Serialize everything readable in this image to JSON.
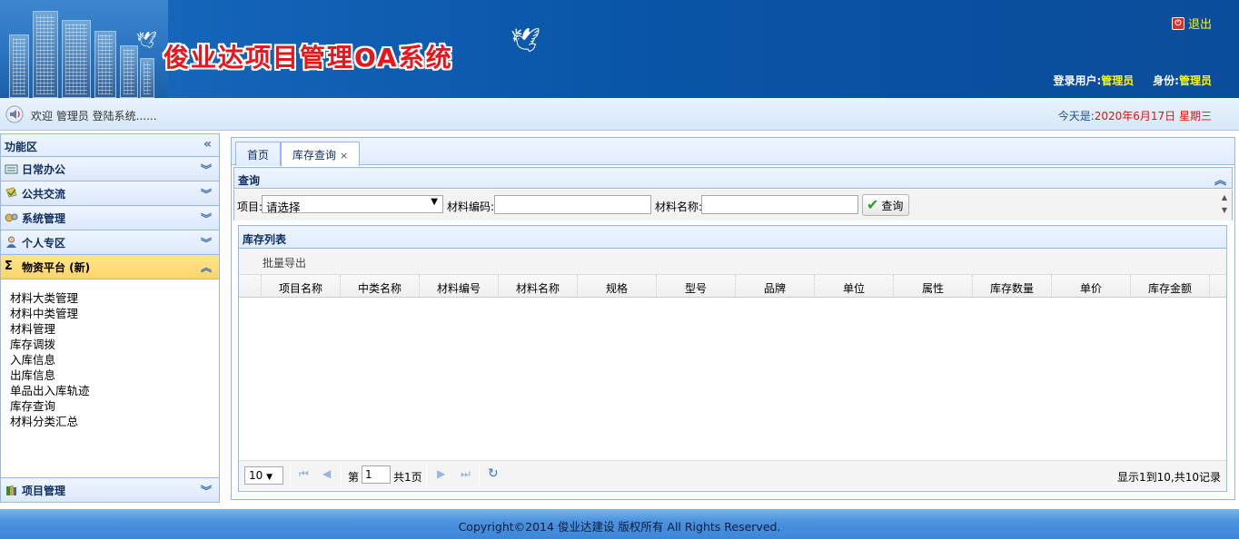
{
  "header": {
    "title": "俊业达项目管理OA系统",
    "logout": "退出",
    "user_label": "登录用户:",
    "user_value": "管理员",
    "role_label": "身份:",
    "role_value": "管理员"
  },
  "welcome": {
    "text": "欢迎 管理员 登陆系统......",
    "date_label": "今天是:",
    "date_value": "2020年6月17日 星期三"
  },
  "sidebar": {
    "title": "功能区",
    "sections": [
      {
        "label": "日常办公"
      },
      {
        "label": "公共交流"
      },
      {
        "label": "系统管理"
      },
      {
        "label": "个人专区"
      },
      {
        "label": "物资平台 (新)"
      }
    ],
    "active_items": [
      "材料大类管理",
      "材料中类管理",
      "材料管理",
      "库存调拨",
      "入库信息",
      "出库信息",
      "单品出入库轨迹",
      "库存查询",
      "材料分类汇总"
    ],
    "bottom_section": "项目管理"
  },
  "tabs": [
    {
      "label": "首页"
    },
    {
      "label": "库存查询",
      "close": "×"
    }
  ],
  "query": {
    "title": "查询",
    "project_label": "项目:",
    "project_selected": "请选择",
    "code_label": "材料编码:",
    "name_label": "材料名称:",
    "button": "查询"
  },
  "grid": {
    "title": "库存列表",
    "export": "批量导出",
    "columns": [
      "项目名称",
      "中类名称",
      "材料编号",
      "材料名称",
      "规格",
      "型号",
      "品牌",
      "单位",
      "属性",
      "库存数量",
      "单价",
      "库存金额"
    ],
    "page_size": "10",
    "page_prefix": "第",
    "page_value": "1",
    "page_total": "共1页",
    "info": "显示1到10,共10记录"
  },
  "footer": {
    "text": "Copyright©2014 俊业达建设 版权所有 All Rights Reserved."
  },
  "colors": {
    "header_blue": "#0a55a8",
    "title_red": "#e8151b",
    "accent_yellow": "#fff500",
    "active_section": "#ffd569",
    "border": "#95b8e7"
  }
}
